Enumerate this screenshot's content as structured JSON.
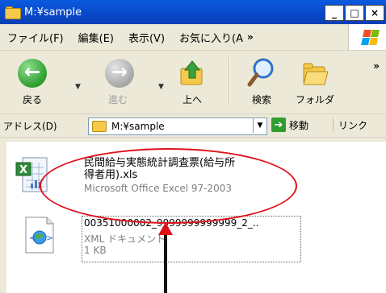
{
  "window": {
    "title": "M:¥sample"
  },
  "menu": {
    "items": [
      "ファイル(F)",
      "編集(E)",
      "表示(V)",
      "お気に入り(A"
    ],
    "more": "»"
  },
  "toolbar": {
    "back": "戻る",
    "forward": "進む",
    "up": "上へ",
    "search": "検索",
    "folders": "フォルダ",
    "more": "»"
  },
  "address": {
    "label": "アドレス(D)",
    "value": "M:¥sample",
    "go": "移動",
    "links": "リンク"
  },
  "files": [
    {
      "name_line1": "民間給与実態統計調査票(給与所",
      "name_line2": "得者用).xls",
      "type": "Microsoft Office Excel 97-2003"
    },
    {
      "name": "00351000002_9999999999999_2_..",
      "type": "XML ドキュメント",
      "size": "1 KB"
    }
  ],
  "colors": {
    "titlebar": "#0847c8",
    "annotation": "#e0101a",
    "excel_green": "#2e8b3a"
  },
  "icons": {
    "back": "back-arrow-icon",
    "forward": "forward-arrow-icon",
    "up": "up-folder-icon",
    "search": "magnifier-icon",
    "folders": "folders-icon",
    "excel": "excel-file-icon",
    "xml": "xml-file-icon"
  }
}
